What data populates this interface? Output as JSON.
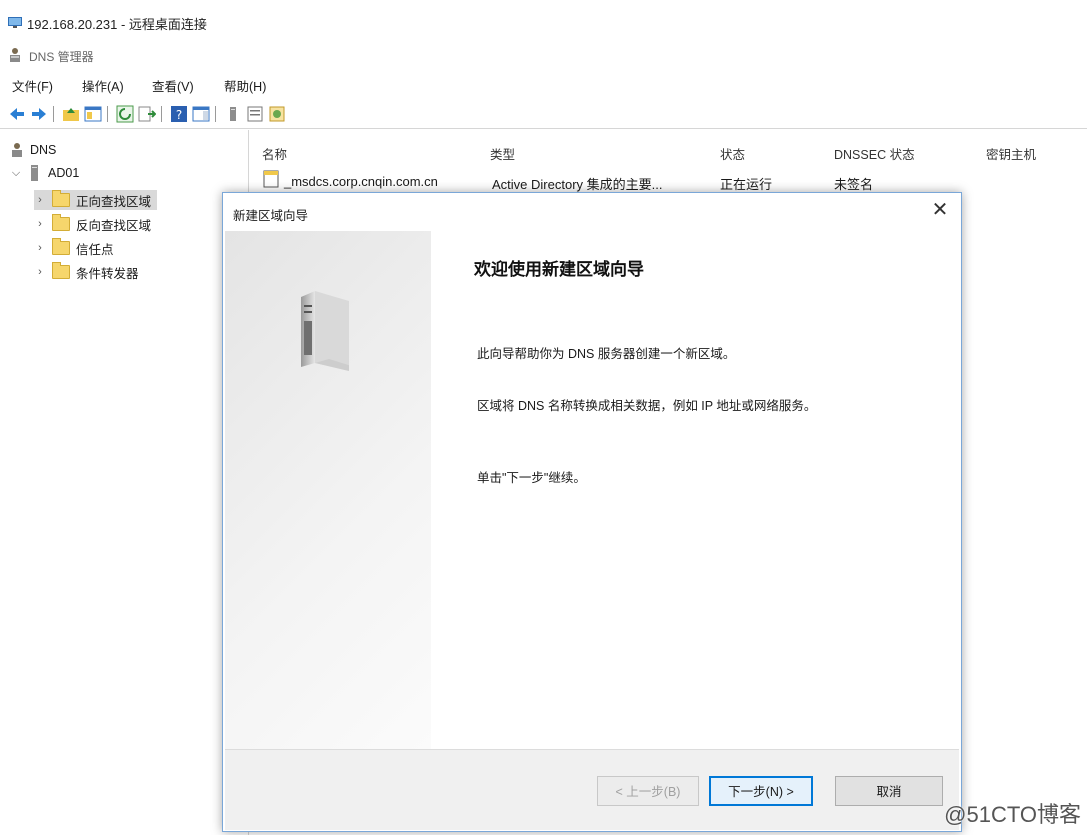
{
  "window": {
    "rdp_title": "192.168.20.231 - 远程桌面连接",
    "app_title": "DNS 管理器"
  },
  "menu": [
    "文件(F)",
    "操作(A)",
    "查看(V)",
    "帮助(H)"
  ],
  "tree": {
    "root": "DNS",
    "server": "AD01",
    "items": [
      "正向查找区域",
      "反向查找区域",
      "信任点",
      "条件转发器"
    ]
  },
  "list": {
    "columns": [
      "名称",
      "类型",
      "状态",
      "DNSSEC 状态",
      "密钥主机"
    ],
    "rows": [
      {
        "name": "_msdcs.corp.cnqin.com.cn",
        "type": "Active Directory 集成的主要...",
        "status": "正在运行",
        "dnssec": "未签名"
      }
    ]
  },
  "dialog": {
    "title": "新建区域向导",
    "heading": "欢迎使用新建区域向导",
    "p1": "此向导帮助你为 DNS 服务器创建一个新区域。",
    "p2": "区域将 DNS 名称转换成相关数据，例如 IP 地址或网络服务。",
    "p3": "单击\"下一步\"继续。",
    "back_label": "< 上一步(B)",
    "next_label": "下一步(N) >",
    "cancel_label": "取消",
    "close_glyph": "✕"
  },
  "watermark": "@51CTO博客",
  "colors": {
    "accent": "#0078d7",
    "folder": "#f6d66c",
    "selection": "#d9d9d9"
  }
}
